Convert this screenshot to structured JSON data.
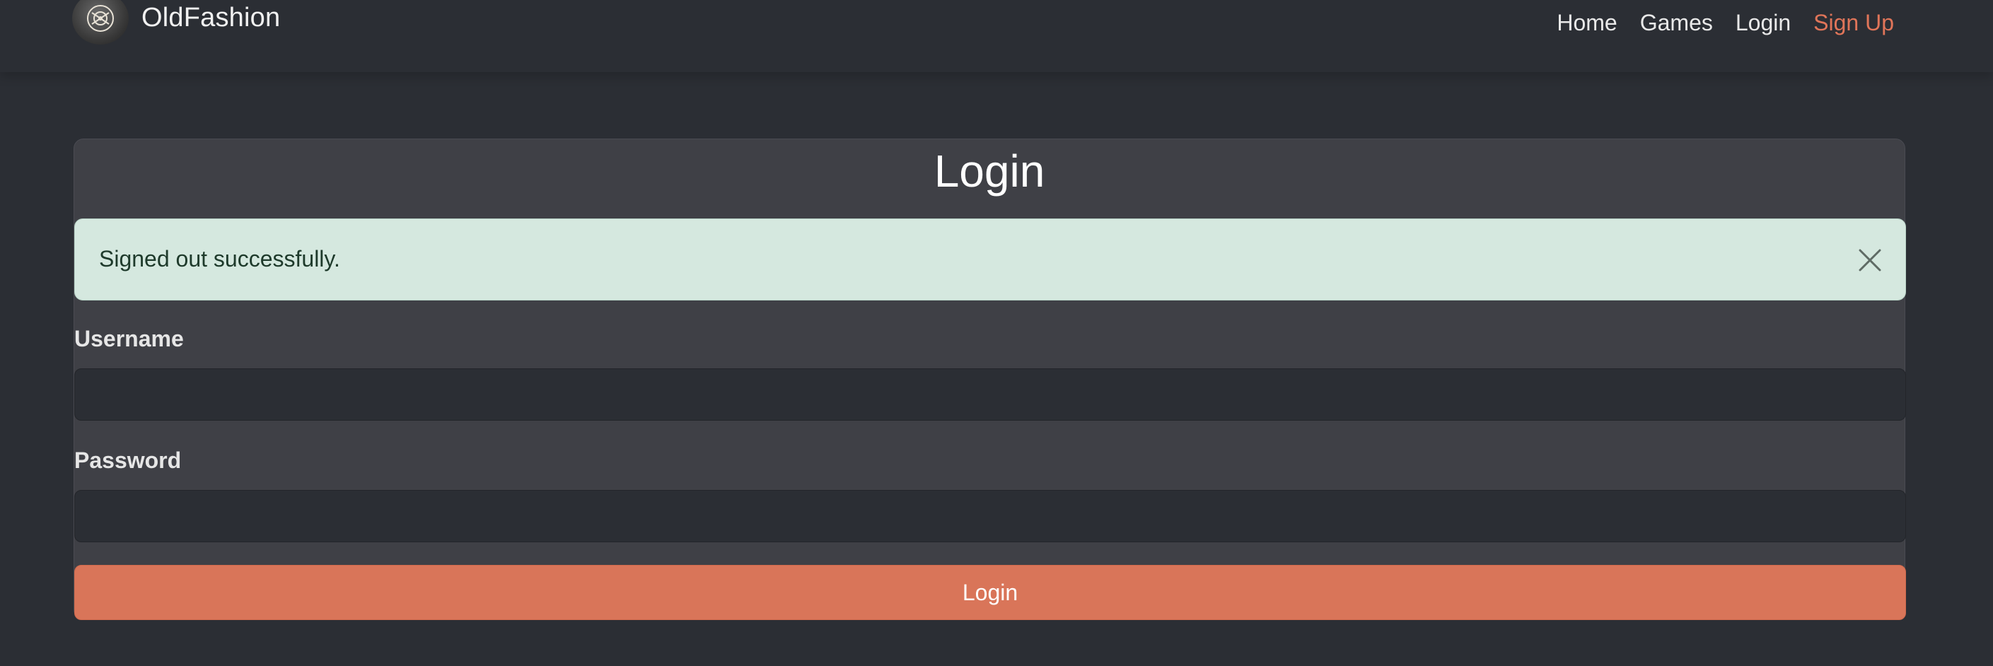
{
  "navbar": {
    "brand_name": "OldFashion",
    "links": [
      {
        "label": "Home"
      },
      {
        "label": "Games"
      },
      {
        "label": "Login"
      },
      {
        "label": "Sign Up"
      }
    ],
    "accent_color": "#e07559"
  },
  "login": {
    "title": "Login",
    "alert": {
      "message": "Signed out successfully.",
      "close_icon": "close-icon"
    },
    "username": {
      "label": "Username",
      "value": "",
      "placeholder": ""
    },
    "password": {
      "label": "Password",
      "value": "",
      "placeholder": ""
    },
    "submit_label": "Login",
    "button_color": "#d97559"
  }
}
